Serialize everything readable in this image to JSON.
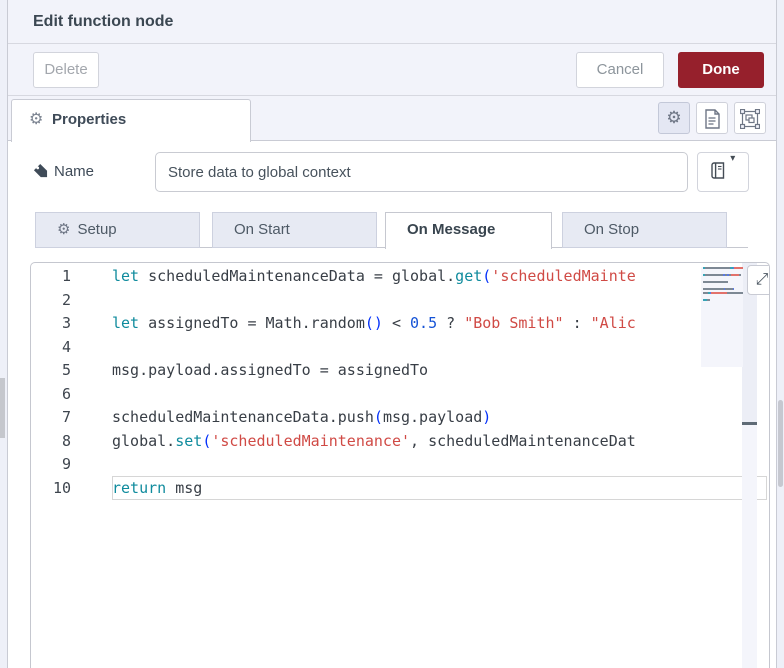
{
  "dialog": {
    "title": "Edit function node"
  },
  "actions": {
    "delete": "Delete",
    "cancel": "Cancel",
    "done": "Done"
  },
  "properties_tab": {
    "label": "Properties"
  },
  "header_icon_buttons": [
    "gear-icon",
    "document-icon",
    "group-selection-icon"
  ],
  "name_field": {
    "label": "Name",
    "value": "Store data to global context",
    "icon": "tag-icon",
    "type_button_icon": "book-icon"
  },
  "function_tabs": [
    {
      "label": "Setup",
      "icon": "gear-icon",
      "active": false
    },
    {
      "label": "On Start",
      "active": false
    },
    {
      "label": "On Message",
      "active": true
    },
    {
      "label": "On Stop",
      "active": false
    }
  ],
  "colors": {
    "done_button": "#96202c",
    "keyword": "#0f8b9d",
    "string": "#d04a45",
    "number": "#1553d6",
    "bracket": "#0431fa",
    "panel_background": "#f2f3fa"
  },
  "icons": {
    "gear": "⚙",
    "expand": "⤢",
    "caret_down": "▾"
  },
  "editor": {
    "language": "javascript",
    "lines": [
      {
        "num": 1,
        "tokens": [
          [
            "k",
            "let"
          ],
          [
            "p",
            " scheduledMaintenanceData = global."
          ],
          [
            "k",
            "get"
          ],
          [
            "b",
            "("
          ],
          [
            "s",
            "'scheduledMainte"
          ]
        ]
      },
      {
        "num": 2,
        "tokens": []
      },
      {
        "num": 3,
        "tokens": [
          [
            "k",
            "let"
          ],
          [
            "p",
            " assignedTo = Math.random"
          ],
          [
            "b",
            "()"
          ],
          [
            "p",
            " < "
          ],
          [
            "n",
            "0.5"
          ],
          [
            "p",
            " ? "
          ],
          [
            "s",
            "\"Bob Smith\""
          ],
          [
            "p",
            " : "
          ],
          [
            "s",
            "\"Alic"
          ]
        ]
      },
      {
        "num": 4,
        "tokens": []
      },
      {
        "num": 5,
        "tokens": [
          [
            "p",
            "msg.payload.assignedTo = assignedTo"
          ]
        ]
      },
      {
        "num": 6,
        "tokens": []
      },
      {
        "num": 7,
        "tokens": [
          [
            "p",
            "scheduledMaintenanceData.push"
          ],
          [
            "b",
            "("
          ],
          [
            "p",
            "msg.payload"
          ],
          [
            "b",
            ")"
          ]
        ]
      },
      {
        "num": 8,
        "tokens": [
          [
            "p",
            "global."
          ],
          [
            "k",
            "set"
          ],
          [
            "b",
            "("
          ],
          [
            "s",
            "'scheduledMaintenance'"
          ],
          [
            "p",
            ", scheduledMaintenanceDat"
          ]
        ]
      },
      {
        "num": 9,
        "tokens": []
      },
      {
        "num": 10,
        "tokens": [
          [
            "k",
            "return"
          ],
          [
            "p",
            " msg"
          ]
        ]
      }
    ],
    "current_line": 10
  }
}
